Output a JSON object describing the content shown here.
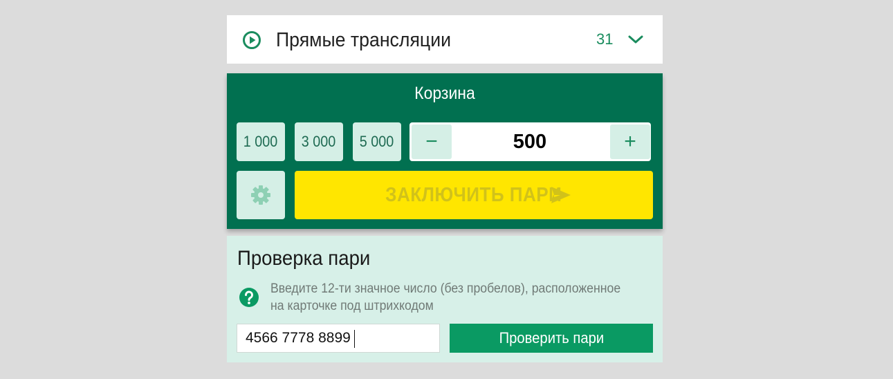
{
  "live": {
    "title": "Прямые трансляции",
    "count": "31",
    "icon": "play-circle-icon",
    "chevron_icon": "chevron-down-icon"
  },
  "cart": {
    "title": "Корзина",
    "presets": [
      "1 000",
      "3 000",
      "5 000"
    ],
    "stepper": {
      "minus": "−",
      "plus": "+",
      "value": "500"
    },
    "settings_icon": "gear-icon",
    "place_bet_label": "ЗАКЛЮЧИТЬ ПАРИ",
    "send_icon": "send-icon"
  },
  "check": {
    "title": "Проверка пари",
    "help_icon": "question-circle-icon",
    "hint": "Введите 12-ти значное число (без пробелов), расположенное на карточке под штрихкодом",
    "input_value": "4566 7778 8899",
    "button_label": "Проверить пари"
  },
  "colors": {
    "background": "#dcdcdc",
    "brand_green": "#017050",
    "accent_green": "#1a8c5e",
    "button_green": "#0a9a63",
    "pale_green": "#d5efe6",
    "panel_mint": "#d7f0e8",
    "yellow": "#ffe600",
    "disabled_text": "#d1c21a"
  }
}
